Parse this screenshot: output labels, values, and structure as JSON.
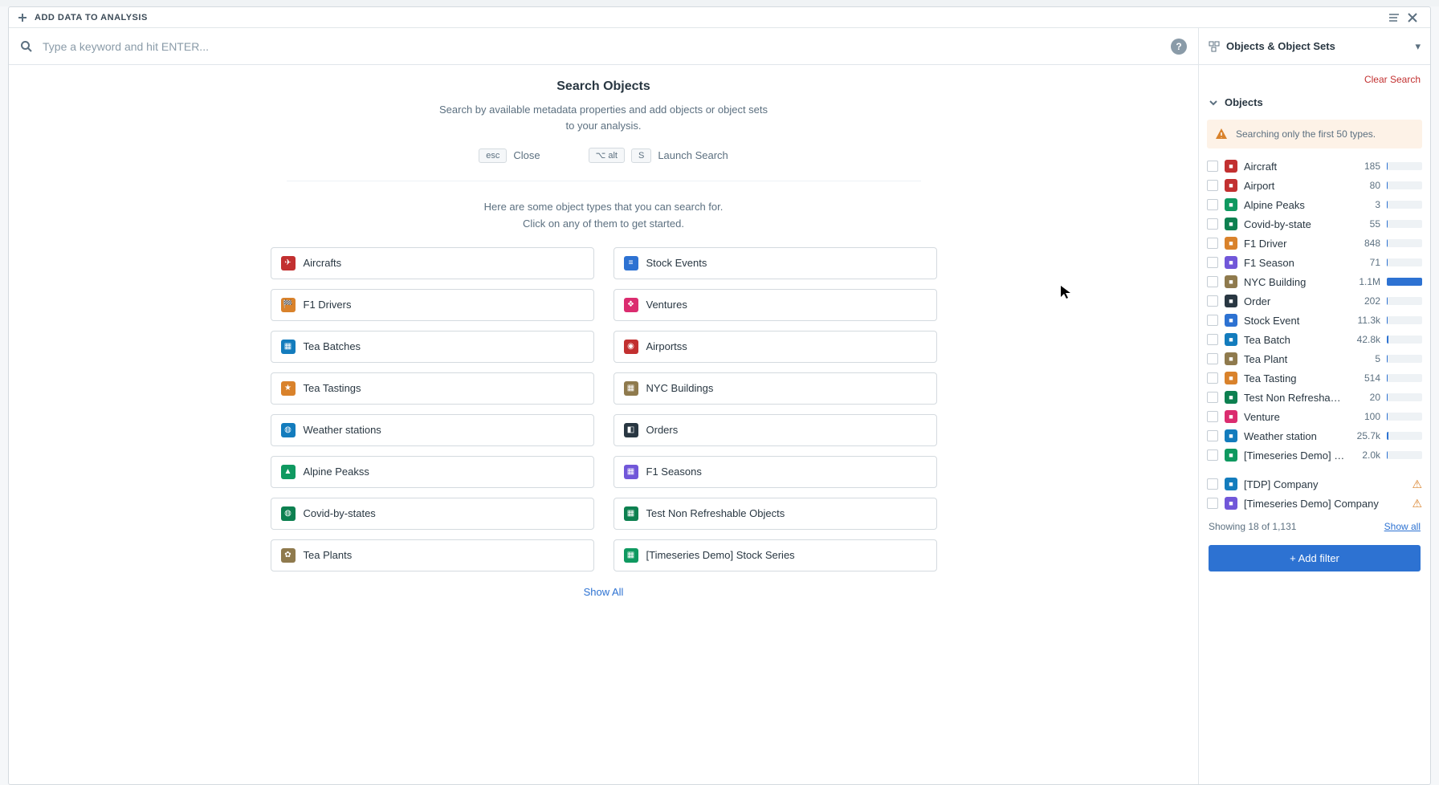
{
  "header": {
    "title": "ADD DATA TO ANALYSIS"
  },
  "search": {
    "placeholder": "Type a keyword and hit ENTER..."
  },
  "intro": {
    "heading": "Search Objects",
    "desc": "Search by available metadata properties and add objects or object sets to your analysis.",
    "close_kbd": "esc",
    "close_txt": "Close",
    "launch_k1": "⌥ alt",
    "launch_k2": "S",
    "launch_txt": "Launch Search",
    "note_l1": "Here are some object types that you can search for.",
    "note_l2": "Click on any of them to get started."
  },
  "tiles": [
    {
      "label": "Aircrafts",
      "color": "#c23030",
      "glyph": "✈"
    },
    {
      "label": "Stock Events",
      "color": "#2d72d2",
      "glyph": "≡"
    },
    {
      "label": "F1 Drivers",
      "color": "#d9822b",
      "glyph": "🏁"
    },
    {
      "label": "Ventures",
      "color": "#db2c6f",
      "glyph": "❖"
    },
    {
      "label": "Tea Batches",
      "color": "#137cbd",
      "glyph": "▦"
    },
    {
      "label": "Airportss",
      "color": "#c23030",
      "glyph": "◉"
    },
    {
      "label": "Tea Tastings",
      "color": "#d9822b",
      "glyph": "★"
    },
    {
      "label": "NYC Buildings",
      "color": "#8f7a4d",
      "glyph": "▦"
    },
    {
      "label": "Weather stations",
      "color": "#137cbd",
      "glyph": "◍"
    },
    {
      "label": "Orders",
      "color": "#293742",
      "glyph": "◧"
    },
    {
      "label": "Alpine Peakss",
      "color": "#0f9960",
      "glyph": "▲"
    },
    {
      "label": "F1 Seasons",
      "color": "#7157d9",
      "glyph": "▦"
    },
    {
      "label": "Covid-by-states",
      "color": "#0d8050",
      "glyph": "◍"
    },
    {
      "label": "Test Non Refreshable Objects",
      "color": "#0d8050",
      "glyph": "▦"
    },
    {
      "label": "Tea Plants",
      "color": "#8f7a4d",
      "glyph": "✿"
    },
    {
      "label": "[Timeseries Demo] Stock Series",
      "color": "#0f9960",
      "glyph": "▦"
    }
  ],
  "show_all": "Show All",
  "side": {
    "title": "Objects & Object Sets",
    "clear": "Clear Search",
    "section": "Objects",
    "warning": "Searching only the first 50 types.",
    "rows": [
      {
        "name": "Aircraft",
        "count": "185",
        "color": "#c23030",
        "pct": 2
      },
      {
        "name": "Airport",
        "count": "80",
        "color": "#c23030",
        "pct": 2
      },
      {
        "name": "Alpine Peaks",
        "count": "3",
        "color": "#0f9960",
        "pct": 2
      },
      {
        "name": "Covid-by-state",
        "count": "55",
        "color": "#0d8050",
        "pct": 2
      },
      {
        "name": "F1 Driver",
        "count": "848",
        "color": "#d9822b",
        "pct": 2
      },
      {
        "name": "F1 Season",
        "count": "71",
        "color": "#7157d9",
        "pct": 2
      },
      {
        "name": "NYC Building",
        "count": "1.1M",
        "color": "#8f7a4d",
        "pct": 100
      },
      {
        "name": "Order",
        "count": "202",
        "color": "#293742",
        "pct": 2
      },
      {
        "name": "Stock Event",
        "count": "11.3k",
        "color": "#2d72d2",
        "pct": 3
      },
      {
        "name": "Tea Batch",
        "count": "42.8k",
        "color": "#137cbd",
        "pct": 5
      },
      {
        "name": "Tea Plant",
        "count": "5",
        "color": "#8f7a4d",
        "pct": 2
      },
      {
        "name": "Tea Tasting",
        "count": "514",
        "color": "#d9822b",
        "pct": 2
      },
      {
        "name": "Test Non Refreshable Object",
        "count": "20",
        "color": "#0d8050",
        "pct": 2
      },
      {
        "name": "Venture",
        "count": "100",
        "color": "#db2c6f",
        "pct": 2
      },
      {
        "name": "Weather station",
        "count": "25.7k",
        "color": "#137cbd",
        "pct": 4
      },
      {
        "name": "[Timeseries Demo] Stock S",
        "count": "2.0k",
        "color": "#0f9960",
        "pct": 2
      }
    ],
    "warn_rows": [
      {
        "name": "[TDP] Company",
        "color": "#137cbd"
      },
      {
        "name": "[Timeseries Demo] Company",
        "color": "#7157d9"
      }
    ],
    "showing": "Showing 18 of 1,131",
    "show_all_link": "Show all",
    "add_filter": "+ Add filter"
  }
}
